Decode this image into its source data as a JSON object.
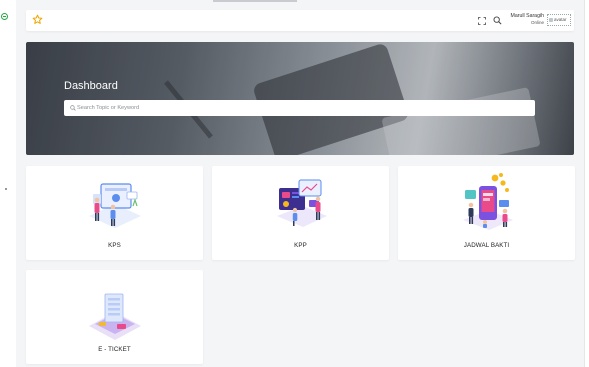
{
  "topbar": {
    "user_name": "Marull Saragih",
    "user_status": "Online",
    "avatar_alt": "avatar",
    "icons": [
      "star-icon",
      "fullscreen-icon",
      "search-icon"
    ]
  },
  "hero": {
    "title": "Dashboard",
    "search_placeholder": "Search Topic or Keyword",
    "search_value": ""
  },
  "cards": [
    {
      "label": "KPS",
      "icon": "kps-illustration"
    },
    {
      "label": "KPP",
      "icon": "kpp-illustration"
    },
    {
      "label": "JADWAL BAKTI",
      "icon": "jadwal-bakti-illustration"
    },
    {
      "label": "E - TICKET",
      "icon": "e-ticket-illustration"
    }
  ],
  "colors": {
    "accent_star": "#f0a500",
    "status_green": "#28a745",
    "illustration_blue": "#5b8def",
    "illustration_purple": "#7b52e0",
    "illustration_pink": "#e94b8a",
    "illustration_yellow": "#f6b91d"
  }
}
